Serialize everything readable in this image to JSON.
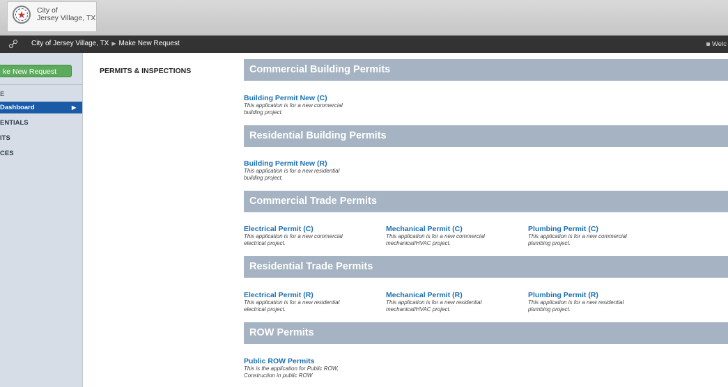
{
  "header": {
    "city_line1": "City of",
    "city_line2": "Jersey Village, TX"
  },
  "breadcrumb": {
    "items": [
      "City of Jersey Village, TX",
      "Make New Request"
    ],
    "welcome": "Welc"
  },
  "sidebar": {
    "new_request_label": "ke New Request",
    "items": [
      {
        "label": "E"
      },
      {
        "label": "Dashboard"
      },
      {
        "label": "ENTIALS"
      },
      {
        "label": "ITS"
      },
      {
        "label": "CES"
      }
    ]
  },
  "main": {
    "section_label": "PERMITS & INSPECTIONS",
    "categories": [
      {
        "title": "Commercial Building Permits",
        "permits": [
          {
            "title": "Building Permit New (C)",
            "desc1": "This application is for a new commercial",
            "desc2": "building project."
          }
        ]
      },
      {
        "title": "Residential Building Permits",
        "permits": [
          {
            "title": "Building Permit New (R)",
            "desc1": "This application is for a new residential",
            "desc2": "building project."
          }
        ]
      },
      {
        "title": "Commercial Trade Permits",
        "permits": [
          {
            "title": "Electrical Permit (C)",
            "desc1": "This application is for a new commercial",
            "desc2": "electrical project."
          },
          {
            "title": "Mechanical Permit (C)",
            "desc1": "This application is for a new commercial",
            "desc2": "mechanical/HVAC project."
          },
          {
            "title": "Plumbing Permit (C)",
            "desc1": "This application is for a new commercial",
            "desc2": "plumbing project."
          }
        ]
      },
      {
        "title": "Residential Trade Permits",
        "permits": [
          {
            "title": "Electrical Permit (R)",
            "desc1": "This application is for a new residential",
            "desc2": "electrical project."
          },
          {
            "title": "Mechanical Permit (R)",
            "desc1": "This application is for a new residential",
            "desc2": "mechanical/HVAC project."
          },
          {
            "title": "Plumbing Permit (R)",
            "desc1": "This application is for a new residential",
            "desc2": "plumbing project."
          }
        ]
      },
      {
        "title": "ROW Permits",
        "permits": [
          {
            "title": "Public ROW Permits",
            "desc1": "This is the application for Public ROW,",
            "desc2": "Construction in public ROW"
          }
        ]
      }
    ]
  },
  "colors": {
    "header_bar": "#a5b3c2",
    "link": "#1b6fb3",
    "new_request_button": "#5cab5c",
    "active_sidebar": "#1a5aa6",
    "breadcrumb_bar": "#333333"
  },
  "icons": {
    "seal": "city-seal-icon",
    "link": "link-icon",
    "chevron": "chevron-right-icon"
  }
}
